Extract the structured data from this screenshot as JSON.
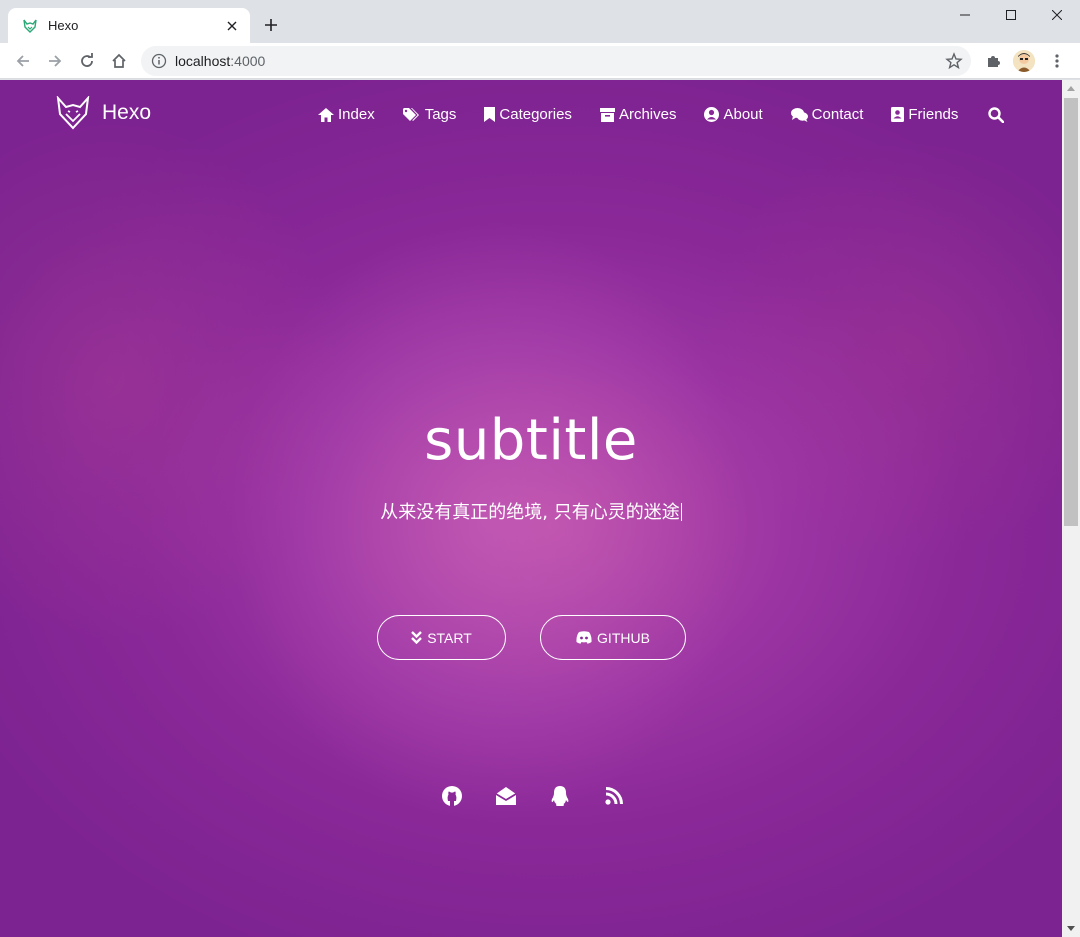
{
  "browser": {
    "tab_title": "Hexo",
    "url_host": "localhost",
    "url_port": ":4000"
  },
  "site": {
    "name": "Hexo",
    "nav": [
      {
        "label": "Index",
        "icon": "home-icon"
      },
      {
        "label": "Tags",
        "icon": "tags-icon"
      },
      {
        "label": "Categories",
        "icon": "bookmark-icon"
      },
      {
        "label": "Archives",
        "icon": "archive-icon"
      },
      {
        "label": "About",
        "icon": "user-circle-icon"
      },
      {
        "label": "Contact",
        "icon": "comments-icon"
      },
      {
        "label": "Friends",
        "icon": "address-book-icon"
      }
    ],
    "search_icon": "search-icon"
  },
  "hero": {
    "title": "subtitle",
    "subtitle": "从来没有真正的绝境, 只有心灵的迷途",
    "start_label": "START",
    "github_label": "GITHUB"
  },
  "social": [
    "github-icon",
    "mail-icon",
    "qq-icon",
    "rss-icon"
  ],
  "colors": {
    "overlay": "#8a2898",
    "text": "#ffffff"
  }
}
